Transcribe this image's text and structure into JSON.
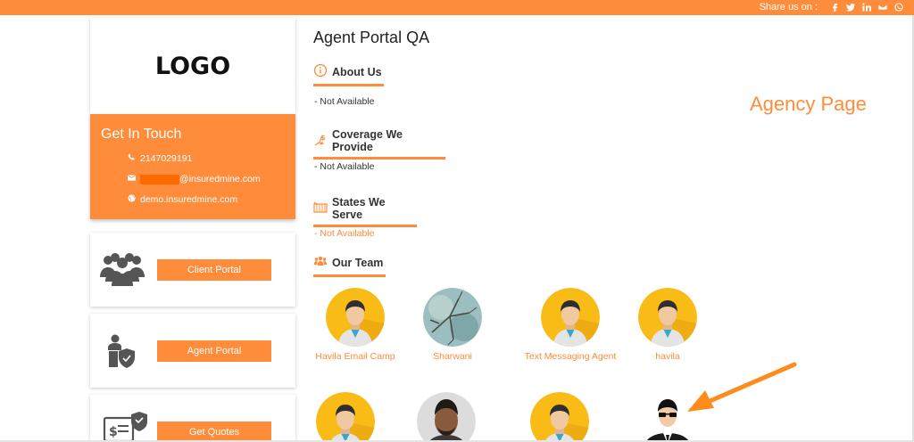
{
  "topbar": {
    "share_label": "Share us on :",
    "icons": [
      "facebook-icon",
      "twitter-icon",
      "linkedin-icon",
      "email-icon",
      "whatsapp-icon"
    ]
  },
  "sidebar": {
    "logo": "LOGO",
    "contact": {
      "title": "Get In Touch",
      "phone": "2147029191",
      "email_suffix": "@insuredmine.com",
      "website": "demo.insuredmine.com"
    },
    "portals": [
      {
        "label": "Client Portal",
        "icon": "group-icon"
      },
      {
        "label": "Agent Portal",
        "icon": "agent-shield-icon"
      },
      {
        "label": "Get Quotes",
        "icon": "quote-document-icon"
      }
    ]
  },
  "main": {
    "title": "Agent Portal QA",
    "sections": [
      {
        "title": "About Us",
        "icon": "info-icon",
        "text": "- Not Available"
      },
      {
        "title": "Coverage We Provide",
        "icon": "hand-dollar-icon",
        "text": "- Not Available"
      },
      {
        "title": "States We Serve",
        "icon": "map-icon",
        "text": "- Not Available"
      },
      {
        "title": "Our Team",
        "icon": "team-icon"
      }
    ],
    "team": [
      {
        "name": "Havila Email Camp"
      },
      {
        "name": "Sharwani"
      },
      {
        "name": "Text Messaging Agent"
      },
      {
        "name": "havila"
      },
      {
        "name": ""
      },
      {
        "name": ""
      },
      {
        "name": ""
      },
      {
        "name": ""
      }
    ]
  },
  "annotation": {
    "label": "Agency Page"
  },
  "colors": {
    "accent": "#ff8c3a",
    "text": "#333333"
  }
}
